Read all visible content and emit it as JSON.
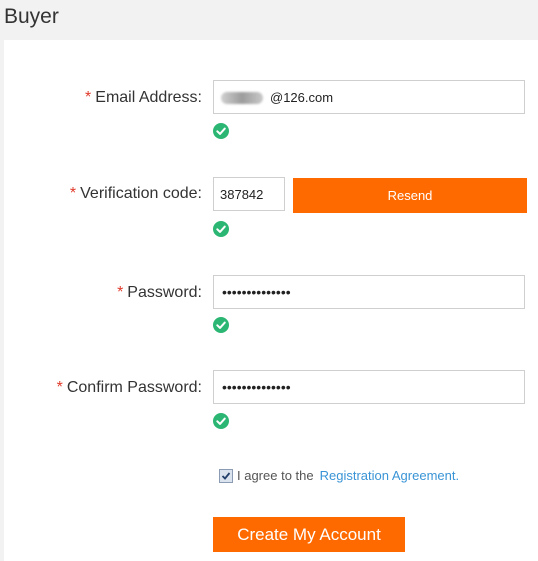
{
  "header": {
    "title": "Buyer"
  },
  "form": {
    "required_mark": "*",
    "email": {
      "label": "Email Address:",
      "value": "@126.com"
    },
    "verification": {
      "label": "Verification code:",
      "value": "387842",
      "resend_label": "Resend"
    },
    "password": {
      "label": "Password:",
      "value": "••••••••••••••"
    },
    "confirm": {
      "label": "Confirm Password:",
      "value": "••••••••••••••"
    },
    "agree": {
      "text": "I agree to the",
      "link": "Registration Agreement.",
      "checked": true
    },
    "submit_label": "Create My Account"
  },
  "colors": {
    "accent": "#ff6a00",
    "valid": "#2bb673",
    "link": "#3a94d6",
    "required": "#e03a2a"
  },
  "icons": {
    "valid": "check-circle-icon"
  }
}
